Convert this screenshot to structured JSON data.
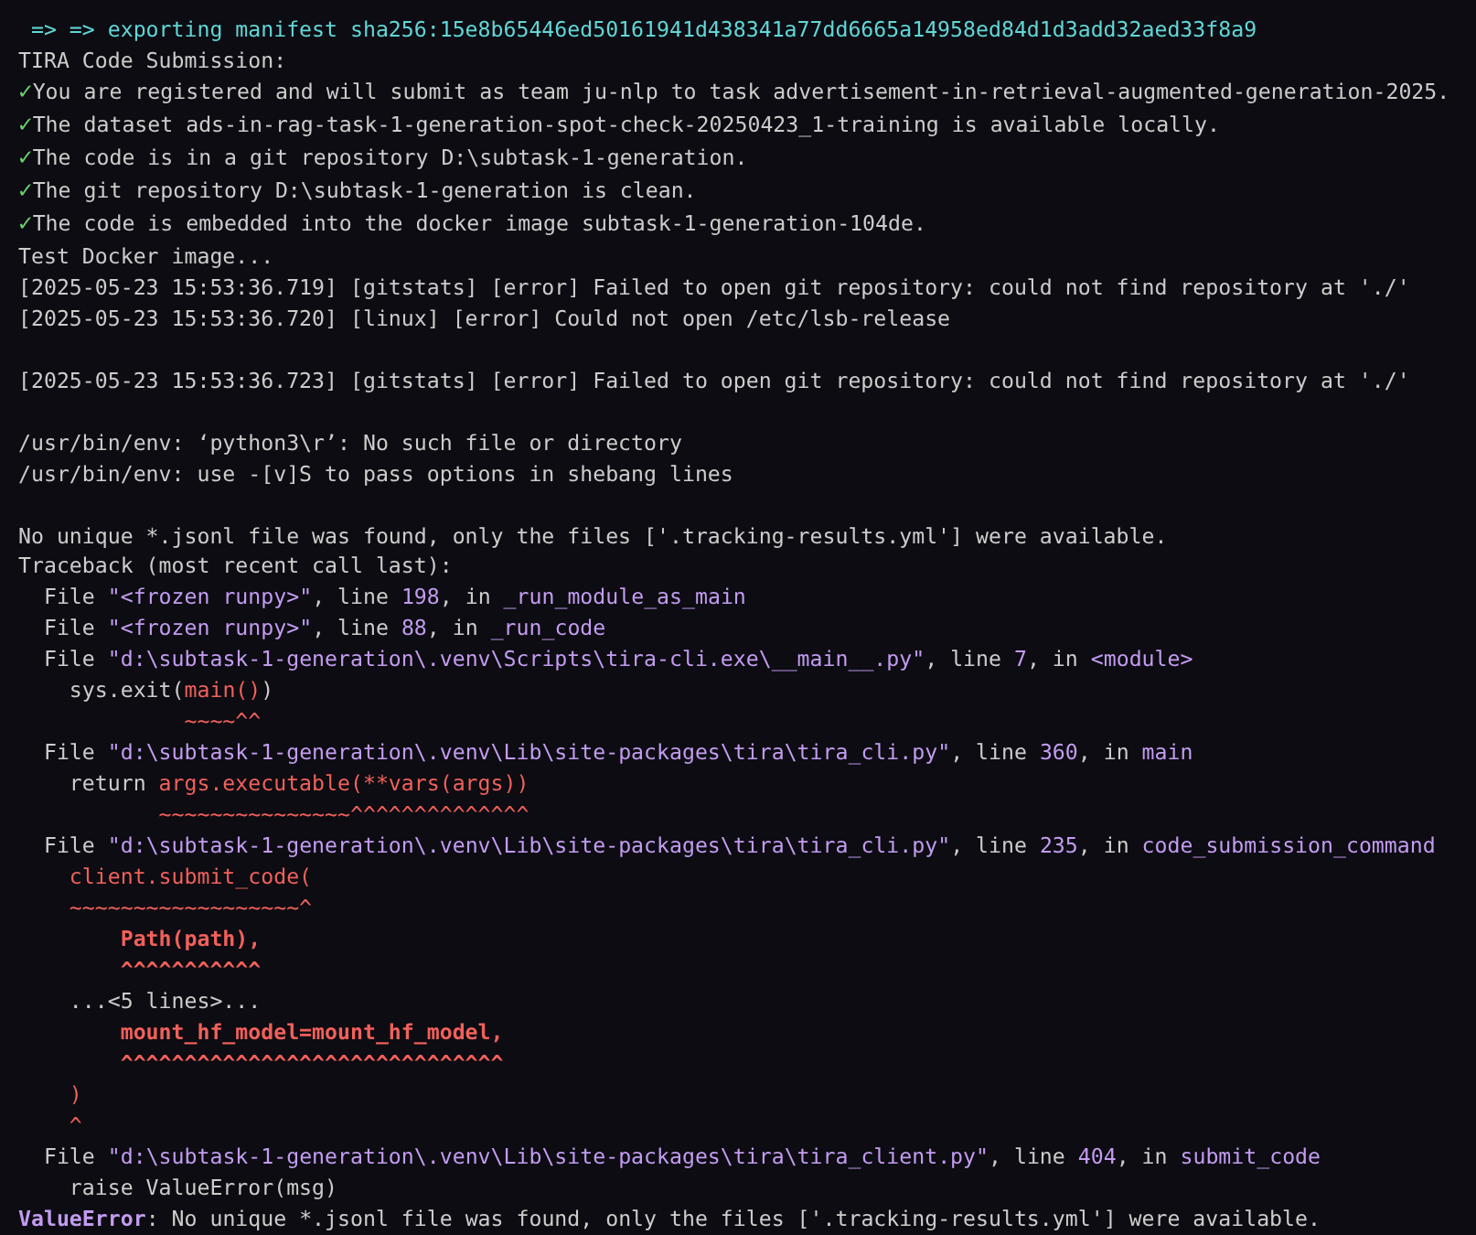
{
  "terminal": {
    "lines": [
      {
        "segments": [
          {
            "text": " => => exporting manifest sha256:15e8b65446ed50161941d438341a77dd6665a14958ed84d1d3add32aed33f8a9",
            "kind": "progress"
          }
        ]
      },
      {
        "segments": [
          {
            "text": "TIRA Code Submission:",
            "kind": "plain"
          }
        ]
      },
      {
        "segments": [
          {
            "text": "✓",
            "kind": "check"
          },
          {
            "text": "You are registered and will submit as team ju-nlp to task advertisement-in-retrieval-augmented-generation-2025.",
            "kind": "plain"
          }
        ]
      },
      {
        "segments": [
          {
            "text": "✓",
            "kind": "check"
          },
          {
            "text": "The dataset ads-in-rag-task-1-generation-spot-check-20250423_1-training is available locally.",
            "kind": "plain"
          }
        ]
      },
      {
        "segments": [
          {
            "text": "✓",
            "kind": "check"
          },
          {
            "text": "The code is in a git repository D:\\subtask-1-generation.",
            "kind": "plain"
          }
        ]
      },
      {
        "segments": [
          {
            "text": "✓",
            "kind": "check"
          },
          {
            "text": "The git repository D:\\subtask-1-generation is clean.",
            "kind": "plain"
          }
        ]
      },
      {
        "segments": [
          {
            "text": "✓",
            "kind": "check"
          },
          {
            "text": "The code is embedded into the docker image subtask-1-generation-104de.",
            "kind": "plain"
          }
        ]
      },
      {
        "segments": [
          {
            "text": "Test Docker image...",
            "kind": "plain"
          }
        ]
      },
      {
        "segments": [
          {
            "text": "[2025-05-23 15:53:36.719] [gitstats] [error] Failed to open git repository: could not find repository at './'",
            "kind": "plain"
          }
        ]
      },
      {
        "segments": [
          {
            "text": "[2025-05-23 15:53:36.720] [linux] [error] Could not open /etc/lsb-release",
            "kind": "plain"
          }
        ]
      },
      {
        "kind": "blank"
      },
      {
        "segments": [
          {
            "text": "[2025-05-23 15:53:36.723] [gitstats] [error] Failed to open git repository: could not find repository at './'",
            "kind": "plain"
          }
        ]
      },
      {
        "kind": "blank"
      },
      {
        "segments": [
          {
            "text": "/usr/bin/env: ‘python3\\r’: No such file or directory",
            "kind": "plain"
          }
        ]
      },
      {
        "segments": [
          {
            "text": "/usr/bin/env: use -[v]S to pass options in shebang lines",
            "kind": "plain"
          }
        ]
      },
      {
        "kind": "blank"
      },
      {
        "segments": [
          {
            "text": "No unique *.jsonl file was found, only the files ['.tracking-results.yml'] were available.",
            "kind": "plain"
          }
        ]
      },
      {
        "segments": [
          {
            "text": "Traceback (most recent call last):",
            "kind": "plain"
          }
        ]
      },
      {
        "segments": [
          {
            "text": "  File ",
            "kind": "plain"
          },
          {
            "text": "\"<frozen runpy>\"",
            "kind": "accent"
          },
          {
            "text": ", line ",
            "kind": "plain"
          },
          {
            "text": "198",
            "kind": "accent"
          },
          {
            "text": ", in ",
            "kind": "plain"
          },
          {
            "text": "_run_module_as_main",
            "kind": "accent"
          }
        ]
      },
      {
        "segments": [
          {
            "text": "  File ",
            "kind": "plain"
          },
          {
            "text": "\"<frozen runpy>\"",
            "kind": "accent"
          },
          {
            "text": ", line ",
            "kind": "plain"
          },
          {
            "text": "88",
            "kind": "accent"
          },
          {
            "text": ", in ",
            "kind": "plain"
          },
          {
            "text": "_run_code",
            "kind": "accent"
          }
        ]
      },
      {
        "segments": [
          {
            "text": "  File ",
            "kind": "plain"
          },
          {
            "text": "\"d:\\subtask-1-generation\\.venv\\Scripts\\tira-cli.exe\\__main__.py\"",
            "kind": "accent"
          },
          {
            "text": ", line ",
            "kind": "plain"
          },
          {
            "text": "7",
            "kind": "accent"
          },
          {
            "text": ", in ",
            "kind": "plain"
          },
          {
            "text": "<module>",
            "kind": "accent"
          }
        ]
      },
      {
        "segments": [
          {
            "text": "    sys.exit(",
            "kind": "plain"
          },
          {
            "text": "main()",
            "kind": "error"
          },
          {
            "text": ")",
            "kind": "plain"
          }
        ]
      },
      {
        "segments": [
          {
            "text": "             ~~~~^^",
            "kind": "error"
          }
        ]
      },
      {
        "segments": [
          {
            "text": "  File ",
            "kind": "plain"
          },
          {
            "text": "\"d:\\subtask-1-generation\\.venv\\Lib\\site-packages\\tira\\tira_cli.py\"",
            "kind": "accent"
          },
          {
            "text": ", line ",
            "kind": "plain"
          },
          {
            "text": "360",
            "kind": "accent"
          },
          {
            "text": ", in ",
            "kind": "plain"
          },
          {
            "text": "main",
            "kind": "accent"
          }
        ]
      },
      {
        "segments": [
          {
            "text": "    return ",
            "kind": "plain"
          },
          {
            "text": "args.executable(**vars(args))",
            "kind": "error"
          }
        ]
      },
      {
        "segments": [
          {
            "text": "           ~~~~~~~~~~~~~~~^^^^^^^^^^^^^^",
            "kind": "error"
          }
        ]
      },
      {
        "segments": [
          {
            "text": "  File ",
            "kind": "plain"
          },
          {
            "text": "\"d:\\subtask-1-generation\\.venv\\Lib\\site-packages\\tira\\tira_cli.py\"",
            "kind": "accent"
          },
          {
            "text": ", line ",
            "kind": "plain"
          },
          {
            "text": "235",
            "kind": "accent"
          },
          {
            "text": ", in ",
            "kind": "plain"
          },
          {
            "text": "code_submission_command",
            "kind": "accent"
          }
        ]
      },
      {
        "segments": [
          {
            "text": "    client.submit_code(",
            "kind": "error"
          }
        ]
      },
      {
        "segments": [
          {
            "text": "    ~~~~~~~~~~~~~~~~~~^",
            "kind": "error"
          }
        ]
      },
      {
        "segments": [
          {
            "text": "        Path(path),",
            "kind": "error_bold"
          }
        ]
      },
      {
        "segments": [
          {
            "text": "        ^^^^^^^^^^^",
            "kind": "error_bold"
          }
        ]
      },
      {
        "segments": [
          {
            "text": "    ...<5 lines>...",
            "kind": "plain"
          }
        ]
      },
      {
        "segments": [
          {
            "text": "        mount_hf_model=mount_hf_model,",
            "kind": "error_bold"
          }
        ]
      },
      {
        "segments": [
          {
            "text": "        ^^^^^^^^^^^^^^^^^^^^^^^^^^^^^^",
            "kind": "error_bold"
          }
        ]
      },
      {
        "segments": [
          {
            "text": "    )",
            "kind": "error"
          }
        ]
      },
      {
        "segments": [
          {
            "text": "    ^",
            "kind": "error"
          }
        ]
      },
      {
        "segments": [
          {
            "text": "  File ",
            "kind": "plain"
          },
          {
            "text": "\"d:\\subtask-1-generation\\.venv\\Lib\\site-packages\\tira\\tira_client.py\"",
            "kind": "accent"
          },
          {
            "text": ", line ",
            "kind": "plain"
          },
          {
            "text": "404",
            "kind": "accent"
          },
          {
            "text": ", in ",
            "kind": "plain"
          },
          {
            "text": "submit_code",
            "kind": "accent"
          }
        ]
      },
      {
        "segments": [
          {
            "text": "    raise ValueError(msg)",
            "kind": "plain"
          }
        ]
      },
      {
        "segments": [
          {
            "text": "ValueError",
            "kind": "exception"
          },
          {
            "text": ": No unique *.jsonl file was found, only the files ['.tracking-results.yml'] were available.",
            "kind": "plain"
          }
        ]
      }
    ]
  }
}
